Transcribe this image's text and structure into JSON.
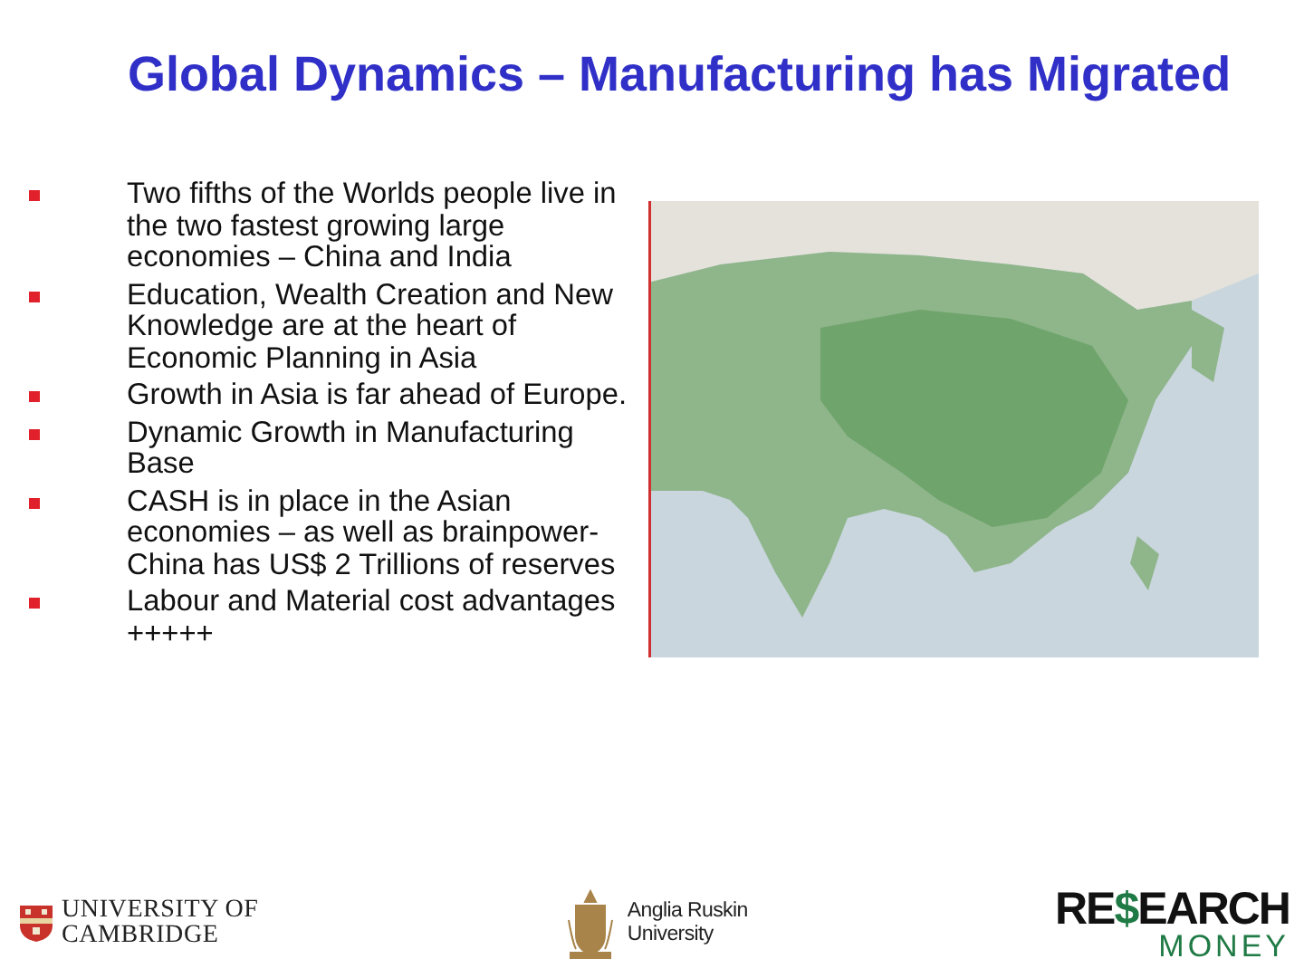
{
  "title": "Global Dynamics – Manufacturing has Migrated",
  "bullets": [
    "Two fifths of the Worlds people live in the two fastest growing large economies – China and India",
    "Education, Wealth Creation and New Knowledge are at the heart of Economic Planning in Asia",
    "Growth in Asia is far ahead of Europe.",
    "Dynamic Growth in Manufacturing Base",
    "CASH is in place in the Asian economies – as well as brainpower- China has US$ 2 Trillions of reserves",
    "Labour and Material cost advantages +++++"
  ],
  "logos": {
    "cambridge": {
      "line_1": "UNIVERSITY OF",
      "line_2": "CAMBRIDGE"
    },
    "anglia": {
      "line_1": "Anglia Ruskin",
      "line_2": "University"
    },
    "research_money": {
      "word_parts": [
        "RE",
        "$",
        "EARCH"
      ],
      "line_2": "MONEY"
    }
  }
}
